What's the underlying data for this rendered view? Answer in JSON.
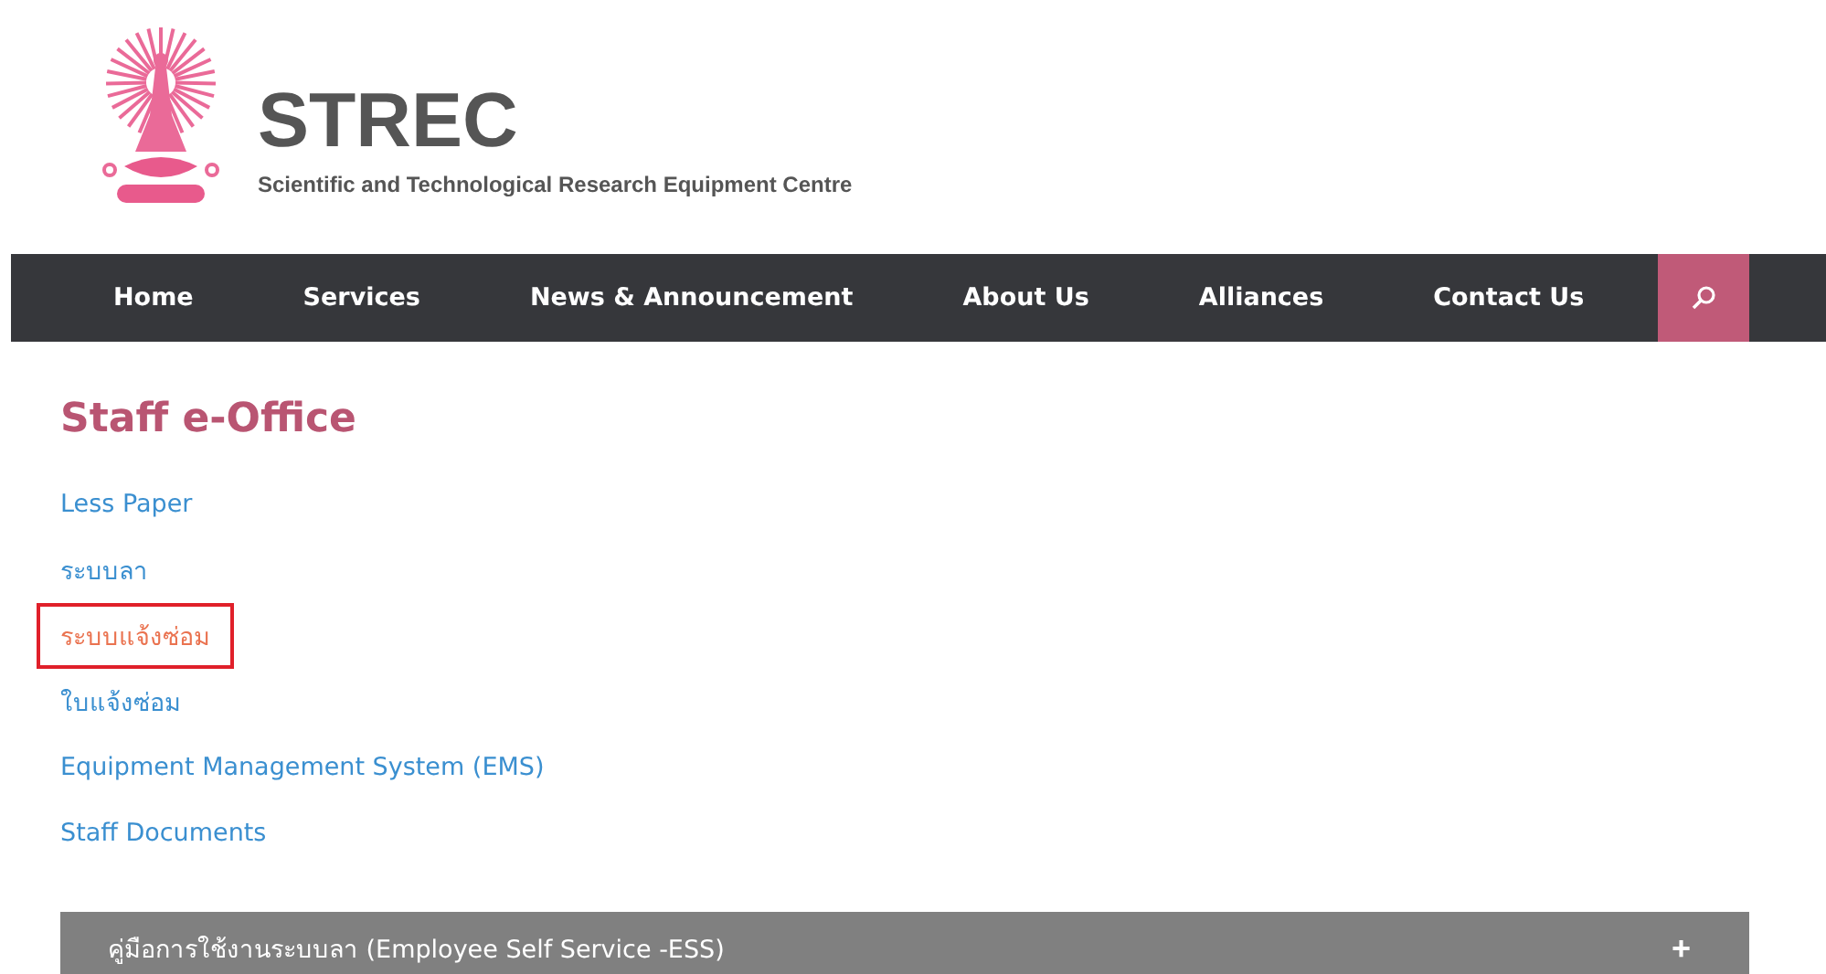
{
  "brand": {
    "name": "STREC",
    "subtitle": "Scientific and Technological Research Equipment Centre"
  },
  "nav": {
    "items": [
      {
        "label": "Home"
      },
      {
        "label": "Services"
      },
      {
        "label": "News & Announcement"
      },
      {
        "label": "About Us"
      },
      {
        "label": "Alliances"
      },
      {
        "label": "Contact Us"
      }
    ]
  },
  "page": {
    "title": "Staff e-Office",
    "links": [
      {
        "label": "Less Paper",
        "highlighted": false
      },
      {
        "label": "ระบบลา",
        "highlighted": false
      },
      {
        "label": "ระบบแจ้งซ่อม",
        "highlighted": true
      },
      {
        "label": "ใบแจ้งซ่อม",
        "highlighted": false
      },
      {
        "label": "Equipment Management System (EMS)",
        "highlighted": false
      },
      {
        "label": "Staff Documents",
        "highlighted": false
      }
    ]
  },
  "accordion": [
    {
      "title": "คู่มือการใช้งานระบบลา (Employee Self Service -ESS)",
      "toggle": "+",
      "expanded": false
    }
  ]
}
